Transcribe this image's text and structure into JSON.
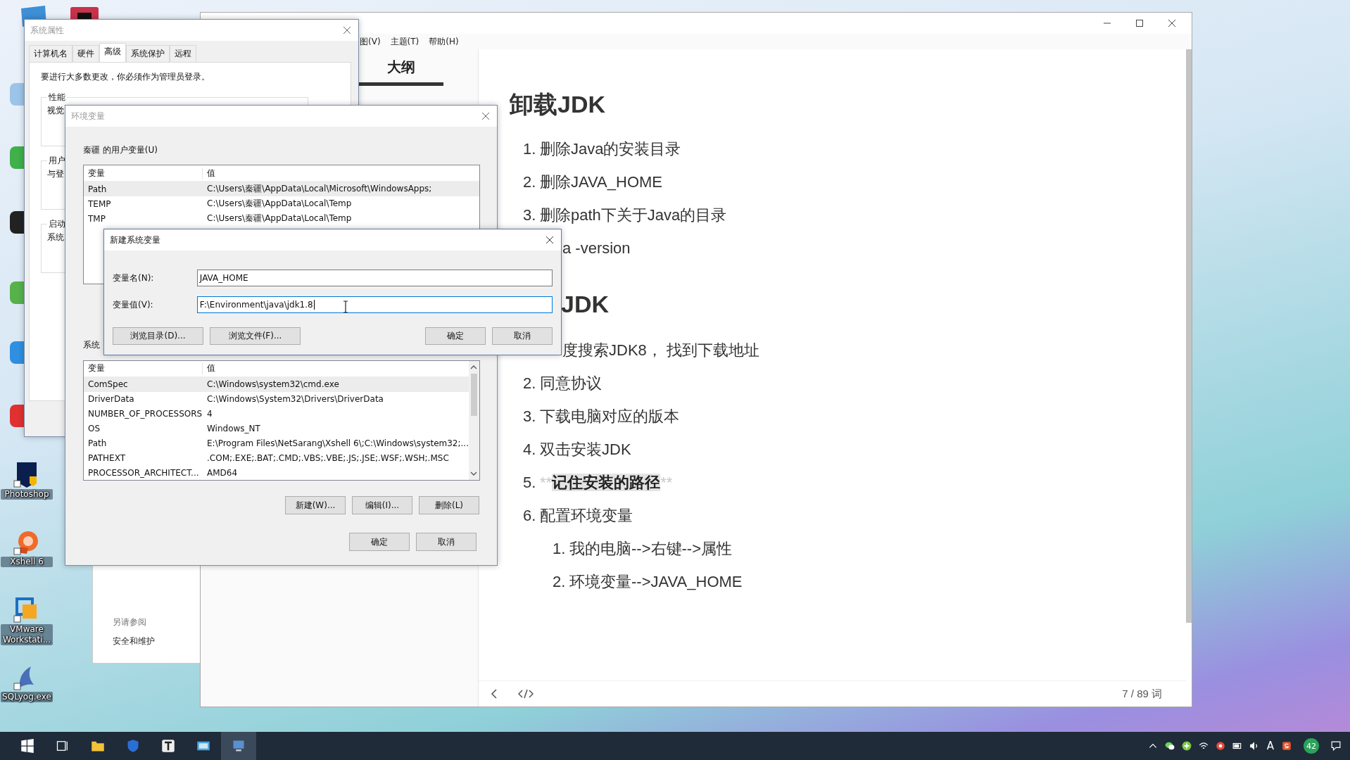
{
  "desktop_icons": [
    {
      "label": "Photoshop",
      "kind": "photoshop"
    },
    {
      "label": "Xshell 6",
      "kind": "xshell"
    },
    {
      "label": "VMware Workstati...",
      "kind": "vmware"
    },
    {
      "label": "SQLyog.exe",
      "kind": "sqlyog"
    }
  ],
  "editor": {
    "menu": [
      "图(V)",
      "主题(T)",
      "帮助(H)"
    ],
    "outline_tab": "大纲",
    "sections": [
      {
        "kind": "full",
        "heading": "卸载JDK",
        "items": [
          {
            "kind": "numbered",
            "number": "1.",
            "text": "删除Java的安装目录"
          },
          {
            "kind": "numbered",
            "number": "2.",
            "text": "删除JAVA_HOME"
          },
          {
            "kind": "numbered",
            "number": "3.",
            "text": "删除path下关于Java的目录"
          },
          {
            "kind": "partial",
            "text": "a -version"
          }
        ]
      },
      {
        "kind": "partial",
        "heading": "JDK",
        "items": [
          {
            "kind": "partial",
            "text": "度搜索JDK8， 找到下载地址"
          },
          {
            "kind": "numbered",
            "number": "2.",
            "text": "同意协议"
          },
          {
            "kind": "numbered",
            "number": "3.",
            "text": "下载电脑对应的版本"
          },
          {
            "kind": "numbered",
            "number": "4.",
            "text": "双击安装JDK"
          },
          {
            "kind": "marked",
            "number": "5.",
            "marker": "**",
            "text": "记住安装的路径"
          },
          {
            "kind": "numbered",
            "number": "6.",
            "text": "配置环境变量",
            "children": [
              {
                "number": "1.",
                "text": "我的电脑-->右键-->属性"
              },
              {
                "number": "2.",
                "text": "环境变量-->JAVA_HOME"
              }
            ]
          }
        ]
      }
    ],
    "word_count": "7 / 89 词"
  },
  "control_panel": {
    "see_also": "另请参阅",
    "link": "安全和维护"
  },
  "system_properties": {
    "title": "系统属性",
    "tabs": [
      {
        "label": "计算机名",
        "selected": false
      },
      {
        "label": "硬件",
        "selected": false
      },
      {
        "label": "高级",
        "selected": true
      },
      {
        "label": "系统保护",
        "selected": false
      },
      {
        "label": "远程",
        "selected": false
      }
    ],
    "notice": "要进行大多数更改，你必须作为管理员登录。",
    "groups": [
      {
        "label": "性能",
        "text": "视觉"
      },
      {
        "label": "用户",
        "text": "与登"
      },
      {
        "label": "启动",
        "text": "系统"
      }
    ]
  },
  "environment_variables": {
    "title": "环境变量",
    "user_label": "秦疆 的用户变量(U)",
    "user_columns": [
      "变量",
      "值"
    ],
    "user_rows": [
      {
        "name": "Path",
        "value": "C:\\Users\\秦疆\\AppData\\Local\\Microsoft\\WindowsApps;",
        "selected": true
      },
      {
        "name": "TEMP",
        "value": "C:\\Users\\秦疆\\AppData\\Local\\Temp",
        "selected": false
      },
      {
        "name": "TMP",
        "value": "C:\\Users\\秦疆\\AppData\\Local\\Temp",
        "selected": false
      }
    ],
    "system_label": "系统",
    "system_columns": [
      "变量",
      "值"
    ],
    "system_rows": [
      {
        "name": "ComSpec",
        "value": "C:\\Windows\\system32\\cmd.exe",
        "selected": true
      },
      {
        "name": "DriverData",
        "value": "C:\\Windows\\System32\\Drivers\\DriverData",
        "selected": false
      },
      {
        "name": "NUMBER_OF_PROCESSORS",
        "value": "4",
        "selected": false
      },
      {
        "name": "OS",
        "value": "Windows_NT",
        "selected": false
      },
      {
        "name": "Path",
        "value": "E:\\Program Files\\NetSarang\\Xshell 6\\;C:\\Windows\\system32;...",
        "selected": false
      },
      {
        "name": "PATHEXT",
        "value": ".COM;.EXE;.BAT;.CMD;.VBS;.VBE;.JS;.JSE;.WSF;.WSH;.MSC",
        "selected": false
      },
      {
        "name": "PROCESSOR_ARCHITECT...",
        "value": "AMD64",
        "selected": false
      }
    ],
    "system_buttons": [
      "新建(W)...",
      "编辑(I)...",
      "删除(L)"
    ],
    "buttons": [
      "确定",
      "取消"
    ]
  },
  "new_variable_dialog": {
    "title": "新建系统变量",
    "fields": [
      {
        "label": "变量名(N):",
        "value": "JAVA_HOME",
        "focused": false
      },
      {
        "label": "变量值(V):",
        "value": "F:\\Environment\\java\\jdk1.8",
        "focused": true
      }
    ],
    "browse_buttons": [
      "浏览目录(D)...",
      "浏览文件(F)..."
    ],
    "buttons": [
      "确定",
      "取消"
    ]
  },
  "taskbar": {
    "input_method": "A",
    "badge": "42"
  }
}
